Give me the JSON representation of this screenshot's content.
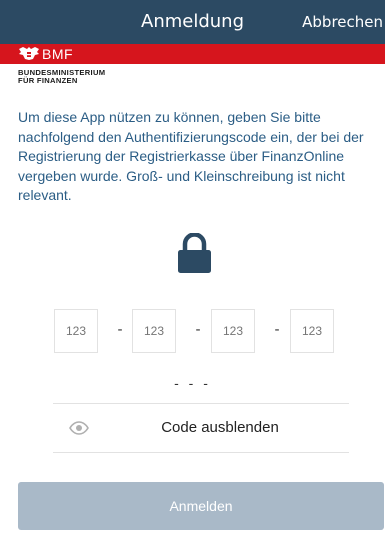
{
  "header": {
    "title": "Anmeldung",
    "cancel_label": "Abbrechen"
  },
  "brand": {
    "abbreviation": "BMF",
    "ministry_line1": "BUNDESMINISTERIUM",
    "ministry_line2": "FÜR FINANZEN",
    "logo_icon": "austrian-eagle-icon",
    "color": "#d6151d"
  },
  "intro_text": "Um diese App nützen zu können, geben Sie bitte nachfolgend den Authentifizierungscode ein, der bei der Registrierung der Registrierkasse über FinanzOnline vergeben wurde. Groß- und Kleinschreibung ist nicht relevant.",
  "lock_icon": "lock-icon",
  "code_fields": [
    {
      "placeholder": "123",
      "value": ""
    },
    {
      "placeholder": "123",
      "value": ""
    },
    {
      "placeholder": "123",
      "value": ""
    },
    {
      "placeholder": "123",
      "value": ""
    }
  ],
  "code_separator": "-",
  "code_preview": "- - -",
  "toggle": {
    "icon": "eye-icon",
    "label": "Code ausblenden"
  },
  "login_button_label": "Anmelden",
  "colors": {
    "header_bg": "#2c4a63",
    "text_blue": "#2b5d85",
    "button_disabled": "#a9b9c8"
  }
}
